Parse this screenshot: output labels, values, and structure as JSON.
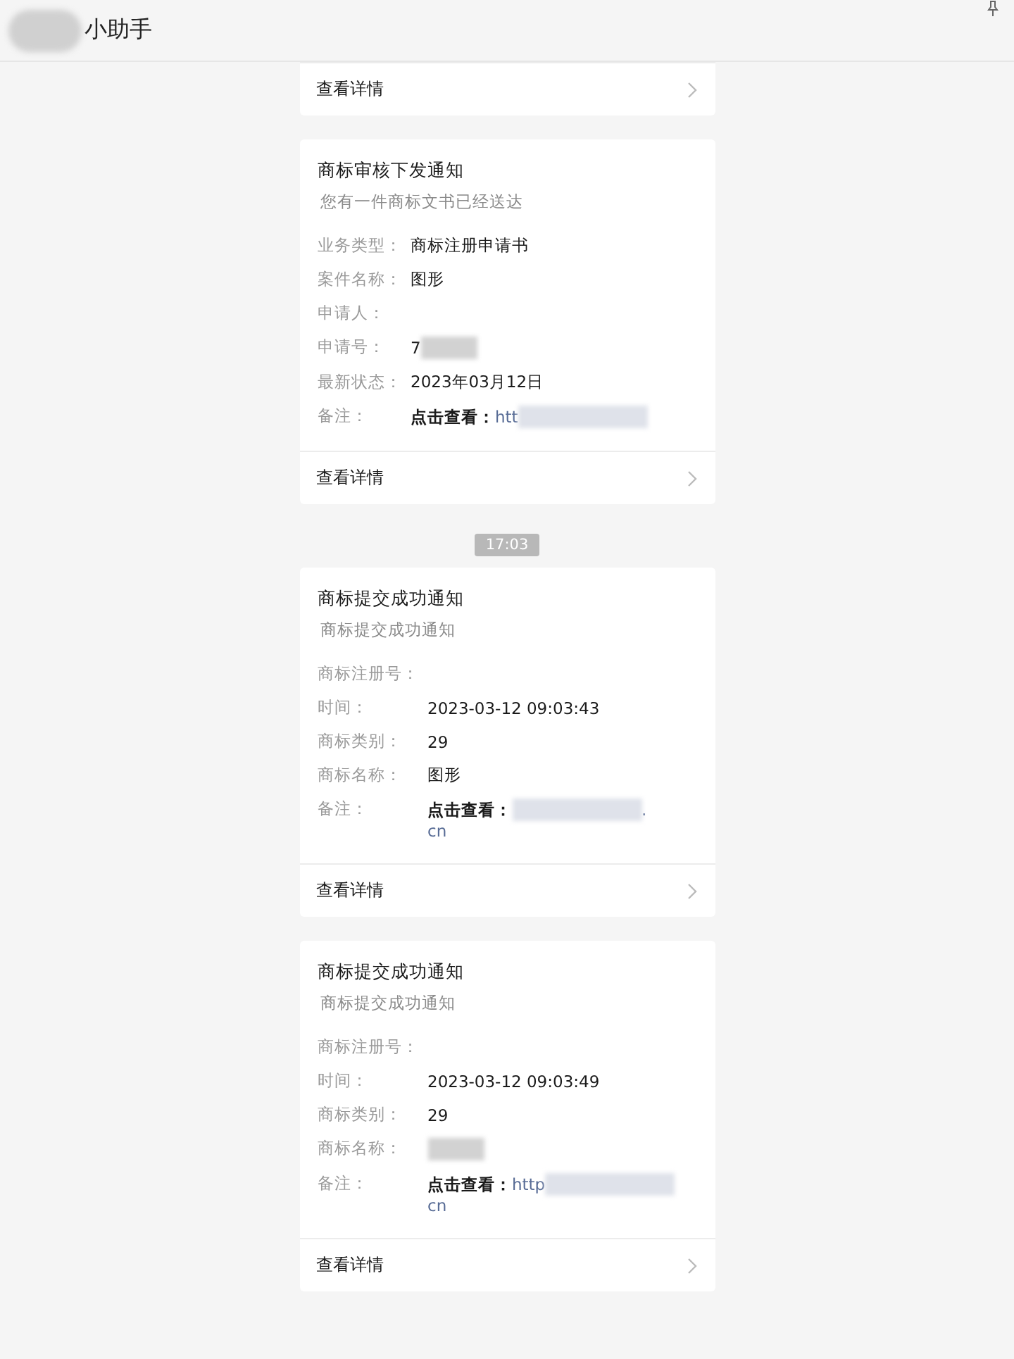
{
  "header": {
    "title": "小助手",
    "avatar_redacted": true
  },
  "top_card": {
    "footer": "查看详情"
  },
  "messages": [
    {
      "kind": "card",
      "title": "商标审核下发通知",
      "subtitle": "您有一件商标文书已经送达",
      "fields": [
        {
          "label": "业务类型：",
          "value": "商标注册申请书"
        },
        {
          "label": "案件名称：",
          "value": "图形"
        },
        {
          "label": "申请人："
        },
        {
          "label": "申请号：",
          "value": "7",
          "redacted": true
        },
        {
          "label": "最新状态：",
          "value": "2023年03月12日"
        },
        {
          "label": "备注：",
          "value": "点击查看：",
          "link": "htt",
          "redacted": true
        }
      ],
      "footer": "查看详情"
    },
    {
      "kind": "time",
      "text": "17:03"
    },
    {
      "kind": "card",
      "title": "商标提交成功通知",
      "subtitle": "商标提交成功通知",
      "fields": [
        {
          "label": "商标注册号："
        },
        {
          "label": "时间：",
          "value": "2023-03-12 09:03:43"
        },
        {
          "label": "商标类别：",
          "value": "29"
        },
        {
          "label": "商标名称：",
          "value": "图形"
        },
        {
          "label": "备注：",
          "value": "点击查看：",
          "redacted": true,
          "link_after": ".",
          "link_line2": "cn"
        }
      ],
      "footer": "查看详情"
    },
    {
      "kind": "card",
      "title": "商标提交成功通知",
      "subtitle": "商标提交成功通知",
      "fields": [
        {
          "label": "商标注册号："
        },
        {
          "label": "时间：",
          "value": "2023-03-12 09:03:49"
        },
        {
          "label": "商标类别：",
          "value": "29"
        },
        {
          "label": "商标名称：",
          "redacted": true
        },
        {
          "label": "备注：",
          "value": "点击查看：",
          "link": "http",
          "redacted": true,
          "link_line2": "cn"
        }
      ],
      "footer": "查看详情"
    }
  ]
}
